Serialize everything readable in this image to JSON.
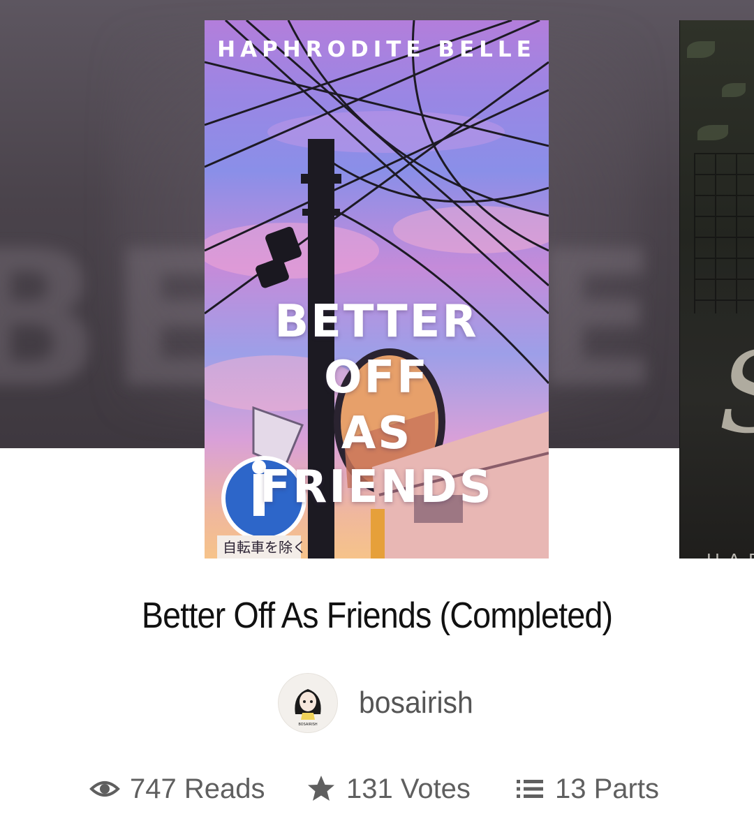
{
  "cover": {
    "author_line": "HAPHRODITE BELLE",
    "title_lines": [
      "BETTER",
      "OFF",
      "AS",
      "FRIENDS"
    ],
    "sign_text": "自転車を除く"
  },
  "side_cover": {
    "partial_text": "HAP"
  },
  "book": {
    "title": "Better Off As Friends (Completed)",
    "author": "bosairish",
    "avatar_caption": "BOSAIRISH"
  },
  "stats": {
    "reads": "747 Reads",
    "votes": "131 Votes",
    "parts": "13 Parts"
  },
  "icons": {
    "reads": "eye-icon",
    "votes": "star-icon",
    "parts": "list-icon"
  }
}
